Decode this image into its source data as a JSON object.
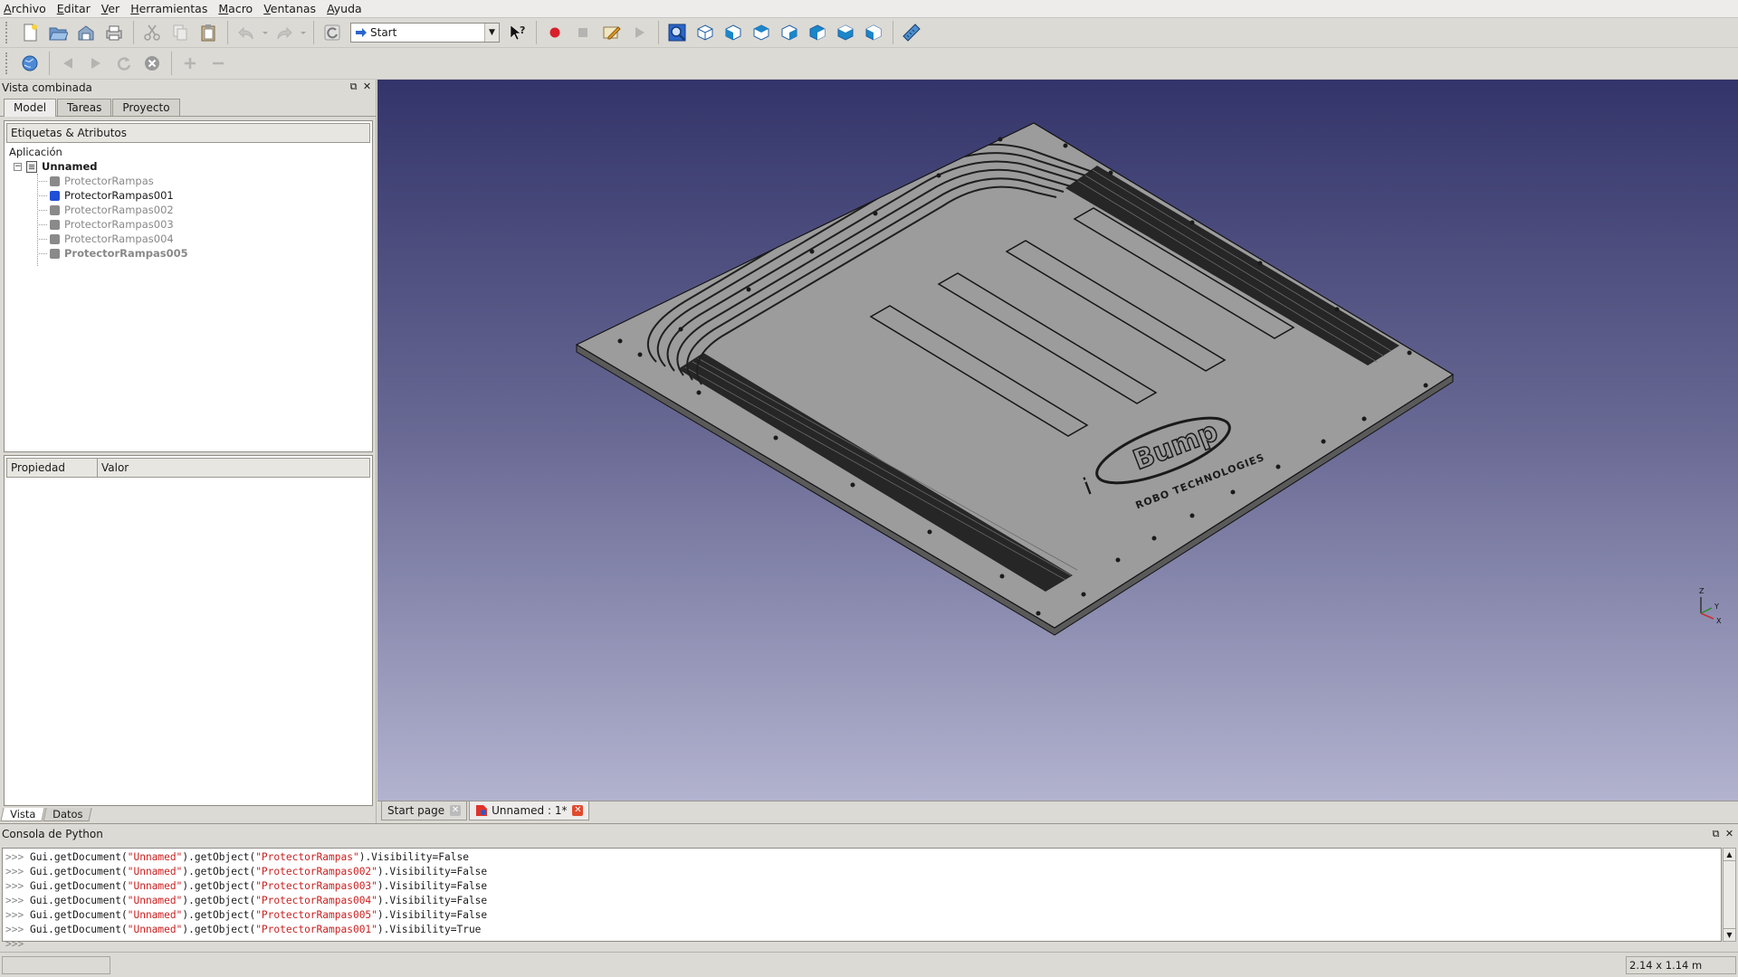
{
  "menu": [
    "Archivo",
    "Editar",
    "Ver",
    "Herramientas",
    "Macro",
    "Ventanas",
    "Ayuda"
  ],
  "workbench": "Start",
  "combo_view": {
    "title": "Vista combinada",
    "tabs": [
      "Model",
      "Tareas",
      "Proyecto"
    ],
    "tree_header": "Etiquetas & Atributos",
    "app_label": "Aplicación",
    "document": "Unnamed",
    "objects": [
      {
        "name": "ProtectorRampas",
        "visible": false
      },
      {
        "name": "ProtectorRampas001",
        "visible": true
      },
      {
        "name": "ProtectorRampas002",
        "visible": false
      },
      {
        "name": "ProtectorRampas003",
        "visible": false
      },
      {
        "name": "ProtectorRampas004",
        "visible": false
      },
      {
        "name": "ProtectorRampas005",
        "visible": false
      }
    ],
    "prop_headers": [
      "Propiedad",
      "Valor"
    ],
    "bottom_tabs": [
      "Vista",
      "Datos"
    ]
  },
  "doc_tabs": [
    "Start page",
    "Unnamed : 1*"
  ],
  "model_logo": {
    "brand": "Bump",
    "tagline": "ROBO TECHNOLOGIES",
    "mark": "i"
  },
  "axis": {
    "z": "Z",
    "y": "Y",
    "x": "X"
  },
  "console": {
    "title": "Consola de Python",
    "lines": [
      {
        "prompt": ">>>",
        "code1": " Gui.getDocument(",
        "doc": "\"Unnamed\"",
        "code2": ").getObject(",
        "obj": "\"ProtectorRampas\"",
        "code3": ").Visibility=False"
      },
      {
        "prompt": ">>>",
        "code1": " Gui.getDocument(",
        "doc": "\"Unnamed\"",
        "code2": ").getObject(",
        "obj": "\"ProtectorRampas002\"",
        "code3": ").Visibility=False"
      },
      {
        "prompt": ">>>",
        "code1": " Gui.getDocument(",
        "doc": "\"Unnamed\"",
        "code2": ").getObject(",
        "obj": "\"ProtectorRampas003\"",
        "code3": ").Visibility=False"
      },
      {
        "prompt": ">>>",
        "code1": " Gui.getDocument(",
        "doc": "\"Unnamed\"",
        "code2": ").getObject(",
        "obj": "\"ProtectorRampas004\"",
        "code3": ").Visibility=False"
      },
      {
        "prompt": ">>>",
        "code1": " Gui.getDocument(",
        "doc": "\"Unnamed\"",
        "code2": ").getObject(",
        "obj": "\"ProtectorRampas005\"",
        "code3": ").Visibility=False"
      },
      {
        "prompt": ">>>",
        "code1": " Gui.getDocument(",
        "doc": "\"Unnamed\"",
        "code2": ").getObject(",
        "obj": "\"ProtectorRampas001\"",
        "code3": ").Visibility=True"
      }
    ],
    "input_prompt": ">>>"
  },
  "status": {
    "dimensions": "2.14 x 1.14 m"
  },
  "colors": {
    "accent_blue": "#1f4fd6",
    "record_red": "#d8202a",
    "tab_close_red": "#e14a2e"
  }
}
